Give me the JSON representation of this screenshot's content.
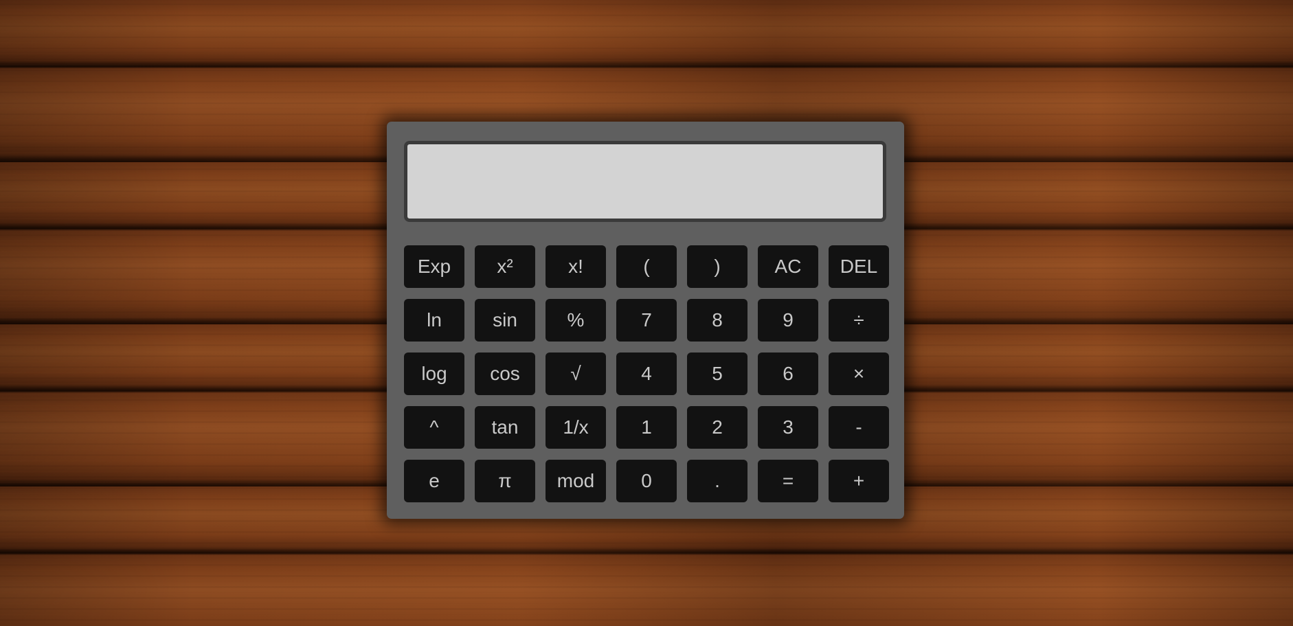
{
  "display": {
    "value": ""
  },
  "keys": [
    {
      "label": "Exp",
      "name": "exp-button"
    },
    {
      "label": "x²",
      "name": "square-button"
    },
    {
      "label": "x!",
      "name": "factorial-button"
    },
    {
      "label": "(",
      "name": "open-paren-button"
    },
    {
      "label": ")",
      "name": "close-paren-button"
    },
    {
      "label": "AC",
      "name": "all-clear-button"
    },
    {
      "label": "DEL",
      "name": "delete-button"
    },
    {
      "label": "ln",
      "name": "ln-button"
    },
    {
      "label": "sin",
      "name": "sin-button"
    },
    {
      "label": "%",
      "name": "percent-button"
    },
    {
      "label": "7",
      "name": "digit-7-button"
    },
    {
      "label": "8",
      "name": "digit-8-button"
    },
    {
      "label": "9",
      "name": "digit-9-button"
    },
    {
      "label": "÷",
      "name": "divide-button"
    },
    {
      "label": "log",
      "name": "log-button"
    },
    {
      "label": "cos",
      "name": "cos-button"
    },
    {
      "label": "√",
      "name": "sqrt-button"
    },
    {
      "label": "4",
      "name": "digit-4-button"
    },
    {
      "label": "5",
      "name": "digit-5-button"
    },
    {
      "label": "6",
      "name": "digit-6-button"
    },
    {
      "label": "×",
      "name": "multiply-button"
    },
    {
      "label": "^",
      "name": "power-button"
    },
    {
      "label": "tan",
      "name": "tan-button"
    },
    {
      "label": "1/x",
      "name": "reciprocal-button"
    },
    {
      "label": "1",
      "name": "digit-1-button"
    },
    {
      "label": "2",
      "name": "digit-2-button"
    },
    {
      "label": "3",
      "name": "digit-3-button"
    },
    {
      "label": "-",
      "name": "subtract-button"
    },
    {
      "label": "e",
      "name": "euler-button"
    },
    {
      "label": "π",
      "name": "pi-button"
    },
    {
      "label": "mod",
      "name": "mod-button"
    },
    {
      "label": "0",
      "name": "digit-0-button"
    },
    {
      "label": ".",
      "name": "decimal-point-button"
    },
    {
      "label": "=",
      "name": "equals-button"
    },
    {
      "label": "+",
      "name": "add-button"
    }
  ]
}
